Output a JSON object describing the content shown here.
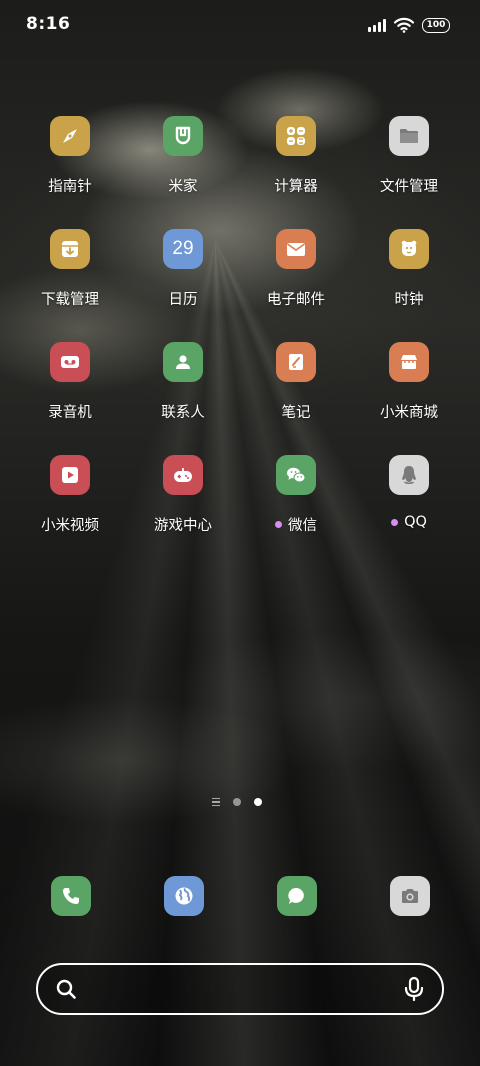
{
  "status_bar": {
    "time": "8:16",
    "battery": "100",
    "icons": [
      "signal-icon",
      "wifi-icon",
      "battery-icon"
    ]
  },
  "apps": [
    {
      "label": "指南针",
      "icon": "compass-icon",
      "color": "#c9a24a"
    },
    {
      "label": "米家",
      "icon": "mijia-icon",
      "color": "#5aa466"
    },
    {
      "label": "计算器",
      "icon": "calculator-icon",
      "color": "#c9a24a"
    },
    {
      "label": "文件管理",
      "icon": "folder-icon",
      "color": "#d8d8d8"
    },
    {
      "label": "下载管理",
      "icon": "download-icon",
      "color": "#c9a24a"
    },
    {
      "label": "日历",
      "icon": "calendar-icon",
      "color": "#6f98d6",
      "badge_text": "29"
    },
    {
      "label": "电子邮件",
      "icon": "mail-icon",
      "color": "#d97e52"
    },
    {
      "label": "时钟",
      "icon": "clock-icon",
      "color": "#c9a24a"
    },
    {
      "label": "录音机",
      "icon": "recorder-icon",
      "color": "#c94e55"
    },
    {
      "label": "联系人",
      "icon": "contact-icon",
      "color": "#5aa466"
    },
    {
      "label": "笔记",
      "icon": "note-icon",
      "color": "#d97e52"
    },
    {
      "label": "小米商城",
      "icon": "store-icon",
      "color": "#d97e52"
    },
    {
      "label": "小米视频",
      "icon": "video-icon",
      "color": "#c94e55"
    },
    {
      "label": "游戏中心",
      "icon": "gamepad-icon",
      "color": "#c94e55"
    },
    {
      "label": "微信",
      "icon": "wechat-icon",
      "color": "#5aa466",
      "new_dot": true
    },
    {
      "label": "QQ",
      "icon": "qq-icon",
      "color": "#d8d8d8",
      "new_dot": true
    }
  ],
  "page_indicator": {
    "pages": 2,
    "active_page": 2
  },
  "dock": [
    {
      "icon": "phone-icon",
      "color": "#5aa466"
    },
    {
      "icon": "browser-icon",
      "color": "#6f98d6"
    },
    {
      "icon": "message-icon",
      "color": "#5aa466"
    },
    {
      "icon": "camera-icon",
      "color": "#d8d8d8"
    }
  ],
  "search_bar": {
    "placeholder": "",
    "icon_left": "search-icon",
    "icon_right": "mic-icon"
  },
  "colors": {
    "new_dot": "#d48ff0"
  }
}
